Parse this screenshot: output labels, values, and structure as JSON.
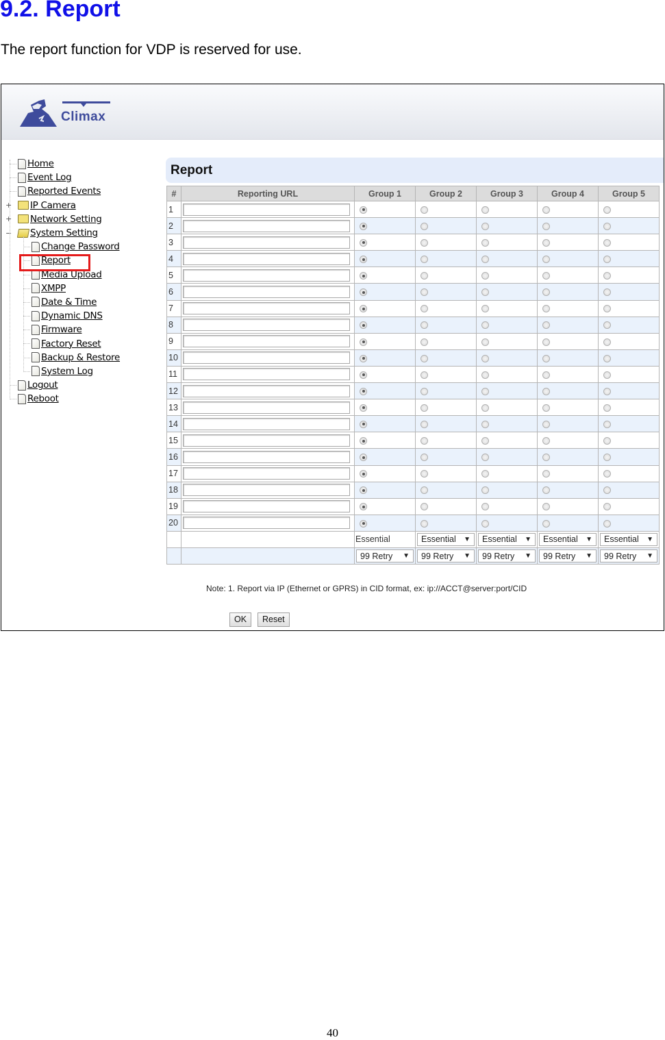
{
  "document": {
    "heading": "9.2. Report",
    "intro": "The report function for VDP is reserved for use.",
    "page_number": "40"
  },
  "app": {
    "brand": "Climax",
    "nav": [
      {
        "label": "Home",
        "level": 1,
        "type": "page"
      },
      {
        "label": "Event Log",
        "level": 1,
        "type": "page"
      },
      {
        "label": "Reported Events",
        "level": 1,
        "type": "page"
      },
      {
        "label": "IP Camera",
        "level": 1,
        "type": "folder",
        "state": "collapsed"
      },
      {
        "label": "Network Setting",
        "level": 1,
        "type": "folder",
        "state": "collapsed"
      },
      {
        "label": "System Setting",
        "level": 1,
        "type": "folder",
        "state": "expanded"
      },
      {
        "label": "Change Password",
        "level": 2,
        "type": "page"
      },
      {
        "label": "Report",
        "level": 2,
        "type": "page",
        "selected": true
      },
      {
        "label": "Media Upload",
        "level": 2,
        "type": "page"
      },
      {
        "label": "XMPP",
        "level": 2,
        "type": "page"
      },
      {
        "label": "Date & Time",
        "level": 2,
        "type": "page"
      },
      {
        "label": "Dynamic DNS",
        "level": 2,
        "type": "page"
      },
      {
        "label": "Firmware",
        "level": 2,
        "type": "page"
      },
      {
        "label": "Factory Reset",
        "level": 2,
        "type": "page"
      },
      {
        "label": "Backup & Restore",
        "level": 2,
        "type": "page"
      },
      {
        "label": "System Log",
        "level": 2,
        "type": "page"
      },
      {
        "label": "Logout",
        "level": 1,
        "type": "page"
      },
      {
        "label": "Reboot",
        "level": 1,
        "type": "page"
      }
    ],
    "highlight_color": "#e41b1b",
    "panel": {
      "title": "Report",
      "columns": [
        "#",
        "Reporting URL",
        "Group 1",
        "Group 2",
        "Group 3",
        "Group 4",
        "Group 5"
      ],
      "rows": [
        {
          "num": "1",
          "url": "",
          "selected_group": 1
        },
        {
          "num": "2",
          "url": "",
          "selected_group": 1
        },
        {
          "num": "3",
          "url": "",
          "selected_group": 1
        },
        {
          "num": "4",
          "url": "",
          "selected_group": 1
        },
        {
          "num": "5",
          "url": "",
          "selected_group": 1
        },
        {
          "num": "6",
          "url": "",
          "selected_group": 1
        },
        {
          "num": "7",
          "url": "",
          "selected_group": 1
        },
        {
          "num": "8",
          "url": "",
          "selected_group": 1
        },
        {
          "num": "9",
          "url": "",
          "selected_group": 1
        },
        {
          "num": "10",
          "url": "",
          "selected_group": 1
        },
        {
          "num": "11",
          "url": "",
          "selected_group": 1
        },
        {
          "num": "12",
          "url": "",
          "selected_group": 1
        },
        {
          "num": "13",
          "url": "",
          "selected_group": 1
        },
        {
          "num": "14",
          "url": "",
          "selected_group": 1
        },
        {
          "num": "15",
          "url": "",
          "selected_group": 1
        },
        {
          "num": "16",
          "url": "",
          "selected_group": 1
        },
        {
          "num": "17",
          "url": "",
          "selected_group": 1
        },
        {
          "num": "18",
          "url": "",
          "selected_group": 1
        },
        {
          "num": "19",
          "url": "",
          "selected_group": 1
        },
        {
          "num": "20",
          "url": "",
          "selected_group": 1
        }
      ],
      "type_row": {
        "group1_label": "Essential",
        "selects": [
          "Essential",
          "Essential",
          "Essential",
          "Essential"
        ]
      },
      "retry_row": {
        "selects": [
          "99 Retry",
          "99 Retry",
          "99 Retry",
          "99 Retry",
          "99 Retry"
        ]
      },
      "note": "Note:  1. Report via IP (Ethernet or GPRS) in CID format, ex: ip://ACCT@server:port/CID",
      "ok_label": "OK",
      "reset_label": "Reset"
    }
  }
}
